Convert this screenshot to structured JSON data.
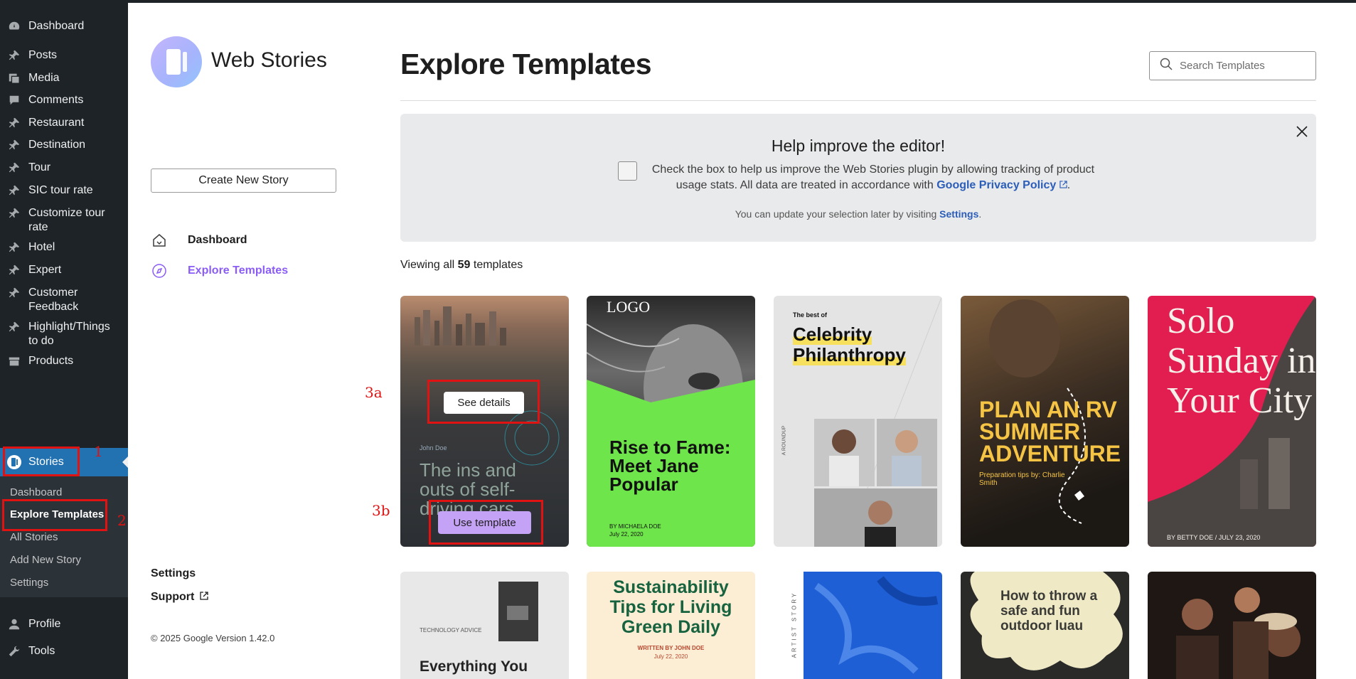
{
  "wp_sidebar": {
    "items": [
      {
        "label": "Dashboard",
        "icon": "gauge-icon"
      },
      {
        "label": "Posts",
        "icon": "pin-icon"
      },
      {
        "label": "Media",
        "icon": "media-icon"
      },
      {
        "label": "Comments",
        "icon": "comment-icon"
      },
      {
        "label": "Restaurant",
        "icon": "pin-icon"
      },
      {
        "label": "Destination",
        "icon": "pin-icon"
      },
      {
        "label": "Tour",
        "icon": "pin-icon"
      },
      {
        "label": "SIC tour rate",
        "icon": "pin-icon"
      },
      {
        "label": "Customize tour rate",
        "icon": "pin-icon"
      },
      {
        "label": "Hotel",
        "icon": "pin-icon"
      },
      {
        "label": "Expert",
        "icon": "pin-icon"
      },
      {
        "label": "Customer Feedback",
        "icon": "pin-icon"
      },
      {
        "label": "Highlight/Things to do",
        "icon": "pin-icon"
      },
      {
        "label": "Products",
        "icon": "archive-icon"
      },
      {
        "label": "Stories",
        "icon": "stories-icon"
      },
      {
        "label": "Profile",
        "icon": "user-icon"
      },
      {
        "label": "Tools",
        "icon": "wrench-icon"
      }
    ],
    "stories_submenu": [
      "Dashboard",
      "Explore Templates",
      "All Stories",
      "Add New Story",
      "Settings"
    ]
  },
  "annotations": {
    "n1": "1",
    "n2": "2",
    "n3a": "3a",
    "n3b": "3b",
    "color": "#e01212"
  },
  "webstories": {
    "title": "Web Stories",
    "create_button": "Create New Story",
    "nav": {
      "dashboard": "Dashboard",
      "explore": "Explore Templates"
    },
    "footer": {
      "settings": "Settings",
      "support": "Support",
      "copyright": "© 2025 Google Version 1.42.0"
    },
    "accent": "#8b5cf6"
  },
  "main": {
    "title": "Explore Templates",
    "search_placeholder": "Search Templates",
    "banner": {
      "title": "Help improve the editor!",
      "text": "Check the box to help us improve the Web Stories plugin by allowing tracking of product usage stats. All data are treated in accordance with ",
      "policy_link": "Google Privacy Policy",
      "period": ".",
      "sub_text": "You can update your selection later by visiting ",
      "settings_link": "Settings",
      "sub_period": "."
    },
    "viewing_prefix": "Viewing all ",
    "viewing_count": "59",
    "viewing_suffix": " templates",
    "overlay": {
      "see_details": "See details",
      "use_template": "Use template"
    },
    "templates_row1": [
      {
        "author": "John Doe",
        "title": "The ins and outs of self-driving cars"
      },
      {
        "logo": "LOGO",
        "title": "Rise to Fame: Meet Jane Popular",
        "byline": "BY MICHAELA DOE",
        "date": "July 22, 2020"
      },
      {
        "kicker": "The best of",
        "title1": "Celebrity",
        "title2": "Philanthropy",
        "side": "A ROUNDUP"
      },
      {
        "title": "PLAN AN RV SUMMER ADVENTURE",
        "sub": "Preparation tips by: Charlie Smith"
      },
      {
        "title": "Solo Sunday in Your City",
        "byline": "BY BETTY DOE / JULY 23, 2020"
      }
    ],
    "templates_row2": [
      {
        "kicker": "TECHNOLOGY ADVICE",
        "title": "Everything You"
      },
      {
        "title": "Sustainability Tips for Living Green Daily",
        "byline": "WRITTEN BY JOHN DOE",
        "date": "July 22, 2020"
      },
      {
        "side": "ARTIST STORY"
      },
      {
        "title": "How to throw a safe and fun outdoor luau"
      },
      {}
    ]
  }
}
